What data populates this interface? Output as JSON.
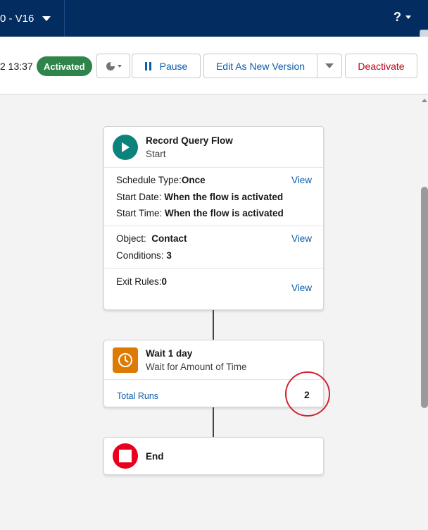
{
  "topbar": {
    "version_label": "0 - V16",
    "help_label": "?"
  },
  "toolbar": {
    "date_text": "2 13:37",
    "status_badge": "Activated",
    "pause_label": "Pause",
    "edit_version_label": "Edit As New Version",
    "deactivate_label": "Deactivate"
  },
  "start_card": {
    "title": "Record Query Flow",
    "subtitle": "Start",
    "schedule": {
      "type_label": "Schedule Type:",
      "type_value": "Once",
      "start_date_label": "Start Date:",
      "start_date_value": "When the flow is activated",
      "start_time_label": "Start Time:",
      "start_time_value": "When the flow is activated",
      "view_label": "View"
    },
    "object": {
      "object_label": "Object:",
      "object_value": "Contact",
      "conditions_label": "Conditions:",
      "conditions_value": "3",
      "view_label": "View"
    },
    "exit_rules": {
      "label": "Exit Rules:",
      "value": "0",
      "view_label": "View"
    }
  },
  "wait_card": {
    "title": "Wait 1 day",
    "subtitle": "Wait for Amount of Time",
    "total_runs_label": "Total Runs",
    "total_runs_value": "2"
  },
  "end_card": {
    "title": "End"
  },
  "colors": {
    "topbar": "#032d60",
    "start_icon": "#0b827c",
    "wait_icon": "#dd7a01",
    "end_icon": "#ea001e",
    "activated_badge": "#2e844a",
    "link": "#0b5cab",
    "deactivate": "#ba0517",
    "highlight_circle": "#d1242f"
  },
  "icons": {
    "start": "play-icon",
    "wait": "clock-icon",
    "end": "stop-icon",
    "debug": "pie-chart-icon"
  }
}
